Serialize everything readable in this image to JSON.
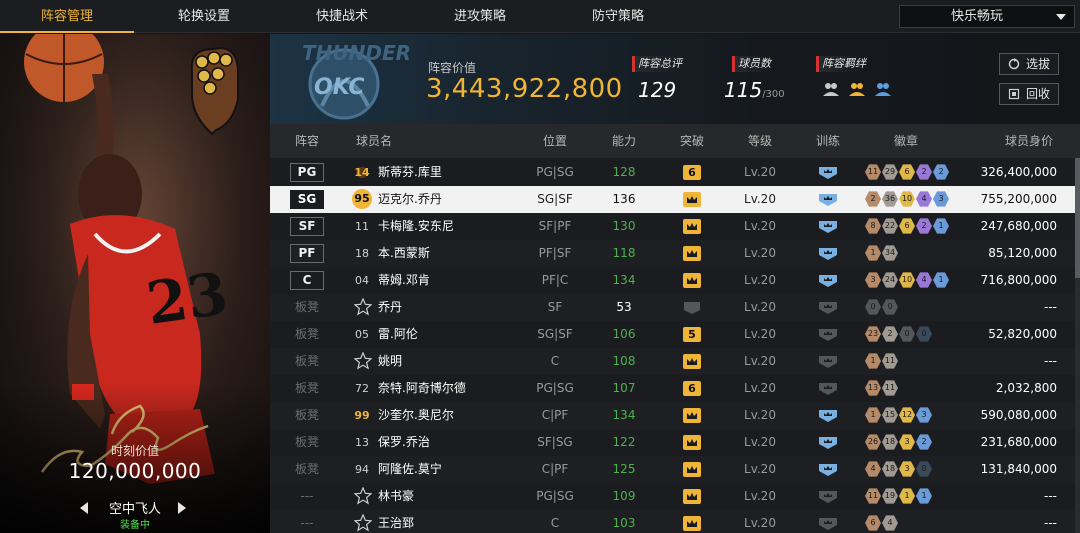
{
  "tabs": [
    {
      "label": "阵容管理",
      "active": true
    },
    {
      "label": "轮换设置",
      "active": false
    },
    {
      "label": "快捷战术",
      "active": false
    },
    {
      "label": "进攻策略",
      "active": false
    },
    {
      "label": "防守策略",
      "active": false
    }
  ],
  "mode_select": {
    "value": "快乐畅玩"
  },
  "card": {
    "value_label": "时刻价值",
    "value": "120,000,000",
    "name": "空中飞人",
    "status": "装备中"
  },
  "header": {
    "lineup_value_label": "阵容价值",
    "lineup_value": "3,443,922,800",
    "rating_label": "阵容总评",
    "rating": "129",
    "players_label": "球员数",
    "players": "115",
    "players_max": "/300",
    "chem_label": "阵容羁绊",
    "btn_scout": "选拔",
    "btn_recall": "回收"
  },
  "columns": [
    "阵容",
    "球员名",
    "位置",
    "能力",
    "突破",
    "等级",
    "训练",
    "徽章",
    "球员身价"
  ],
  "colors": {
    "accent": "#f0b436",
    "green": "#4eb04e",
    "red": "#d63232"
  },
  "rows": [
    {
      "slot": "PG",
      "starter": true,
      "num": "14",
      "num_style": "gold-star",
      "name": "斯蒂芬.库里",
      "pos": "PG|SG",
      "ovr": "128",
      "ovr_color": "green",
      "break": "6",
      "level": "Lv.20",
      "train": true,
      "badges": [
        [
          "11",
          "#b58a68"
        ],
        [
          "29",
          "#a09a92"
        ],
        [
          "6",
          "#e0b84a"
        ],
        [
          "2",
          "#9a78d8"
        ],
        [
          "2",
          "#6a9ad8"
        ]
      ],
      "price": "326,400,000"
    },
    {
      "slot": "SG",
      "starter": true,
      "num": "95",
      "num_style": "gold-circle",
      "name": "迈克尔.乔丹",
      "pos": "SG|SF",
      "ovr": "136",
      "ovr_color": "white",
      "break": "crown",
      "level": "Lv.20",
      "train": true,
      "badges": [
        [
          "2",
          "#b58a68"
        ],
        [
          "36",
          "#a09a92"
        ],
        [
          "10",
          "#e0b84a"
        ],
        [
          "4",
          "#9a78d8"
        ],
        [
          "3",
          "#6a9ad8"
        ]
      ],
      "price": "755,200,000",
      "selected": true
    },
    {
      "slot": "SF",
      "starter": true,
      "num": "11",
      "num_style": "plain",
      "name": "卡梅隆.安东尼",
      "pos": "SF|PF",
      "ovr": "130",
      "ovr_color": "green",
      "break": "crown",
      "level": "Lv.20",
      "train": true,
      "badges": [
        [
          "8",
          "#b58a68"
        ],
        [
          "22",
          "#a09a92"
        ],
        [
          "6",
          "#e0b84a"
        ],
        [
          "2",
          "#9a78d8"
        ],
        [
          "1",
          "#6a9ad8"
        ]
      ],
      "price": "247,680,000"
    },
    {
      "slot": "PF",
      "starter": true,
      "num": "18",
      "num_style": "plain",
      "name": "本.西蒙斯",
      "pos": "PF|SF",
      "ovr": "118",
      "ovr_color": "green",
      "break": "crown",
      "level": "Lv.20",
      "train": true,
      "badges": [
        [
          "1",
          "#b58a68"
        ],
        [
          "34",
          "#a09a92"
        ]
      ],
      "price": "85,120,000"
    },
    {
      "slot": "C",
      "starter": true,
      "num": "04",
      "num_style": "plain",
      "name": "蒂姆.邓肯",
      "pos": "PF|C",
      "ovr": "134",
      "ovr_color": "green",
      "break": "crown",
      "level": "Lv.20",
      "train": true,
      "badges": [
        [
          "3",
          "#b58a68"
        ],
        [
          "24",
          "#a09a92"
        ],
        [
          "10",
          "#e0b84a"
        ],
        [
          "4",
          "#9a78d8"
        ],
        [
          "1",
          "#6a9ad8"
        ]
      ],
      "price": "716,800,000"
    },
    {
      "slot": "板凳",
      "starter": false,
      "num": "",
      "num_style": "star",
      "name": "乔丹",
      "pos": "SF",
      "ovr": "53",
      "ovr_color": "white",
      "break": "none",
      "level": "Lv.20",
      "train": false,
      "badges": [
        [
          "0",
          "#55565a"
        ],
        [
          "0",
          "#55565a"
        ]
      ],
      "price": "---"
    },
    {
      "slot": "板凳",
      "starter": false,
      "num": "05",
      "num_style": "plain",
      "name": "雷.阿伦",
      "pos": "SG|SF",
      "ovr": "106",
      "ovr_color": "green",
      "break": "5",
      "level": "Lv.20",
      "train": false,
      "badges": [
        [
          "23",
          "#b58a68"
        ],
        [
          "2",
          "#a09a92"
        ],
        [
          "0",
          "#55565a"
        ],
        [
          "0",
          "#3a4a5a"
        ]
      ],
      "price": "52,820,000"
    },
    {
      "slot": "板凳",
      "starter": false,
      "num": "",
      "num_style": "star",
      "name": "姚明",
      "pos": "C",
      "ovr": "108",
      "ovr_color": "green",
      "break": "crown",
      "level": "Lv.20",
      "train": false,
      "badges": [
        [
          "1",
          "#b58a68"
        ],
        [
          "11",
          "#a09a92"
        ]
      ],
      "price": "---"
    },
    {
      "slot": "板凳",
      "starter": false,
      "num": "72",
      "num_style": "plain",
      "name": "奈特.阿奇博尔德",
      "pos": "PG|SG",
      "ovr": "107",
      "ovr_color": "green",
      "break": "6",
      "level": "Lv.20",
      "train": false,
      "badges": [
        [
          "13",
          "#b58a68"
        ],
        [
          "11",
          "#a09a92"
        ]
      ],
      "price": "2,032,800"
    },
    {
      "slot": "板凳",
      "starter": false,
      "num": "99",
      "num_style": "gold",
      "name": "沙奎尔.奥尼尔",
      "pos": "C|PF",
      "ovr": "134",
      "ovr_color": "green",
      "break": "crown",
      "level": "Lv.20",
      "train": true,
      "badges": [
        [
          "1",
          "#b58a68"
        ],
        [
          "15",
          "#a09a92"
        ],
        [
          "12",
          "#e0b84a"
        ],
        [
          "3",
          "#6a9ad8"
        ]
      ],
      "price": "590,080,000"
    },
    {
      "slot": "板凳",
      "starter": false,
      "num": "13",
      "num_style": "plain",
      "name": "保罗.乔治",
      "pos": "SF|SG",
      "ovr": "122",
      "ovr_color": "green",
      "break": "crown",
      "level": "Lv.20",
      "train": true,
      "badges": [
        [
          "26",
          "#b58a68"
        ],
        [
          "18",
          "#a09a92"
        ],
        [
          "3",
          "#e0b84a"
        ],
        [
          "2",
          "#6a9ad8"
        ]
      ],
      "price": "231,680,000"
    },
    {
      "slot": "板凳",
      "starter": false,
      "num": "94",
      "num_style": "plain",
      "name": "阿隆佐.莫宁",
      "pos": "C|PF",
      "ovr": "125",
      "ovr_color": "green",
      "break": "crown",
      "level": "Lv.20",
      "train": true,
      "badges": [
        [
          "4",
          "#b58a68"
        ],
        [
          "18",
          "#a09a92"
        ],
        [
          "3",
          "#e0b84a"
        ],
        [
          "0",
          "#3a4a5a"
        ]
      ],
      "price": "131,840,000"
    },
    {
      "slot": "---",
      "starter": false,
      "num": "",
      "num_style": "star",
      "name": "林书豪",
      "pos": "PG|SG",
      "ovr": "109",
      "ovr_color": "green",
      "break": "crown",
      "level": "Lv.20",
      "train": false,
      "badges": [
        [
          "11",
          "#b58a68"
        ],
        [
          "19",
          "#a09a92"
        ],
        [
          "1",
          "#e0b84a"
        ],
        [
          "1",
          "#6a9ad8"
        ]
      ],
      "price": "---"
    },
    {
      "slot": "---",
      "starter": false,
      "num": "",
      "num_style": "star",
      "name": "王治郅",
      "pos": "C",
      "ovr": "103",
      "ovr_color": "green",
      "break": "crown",
      "level": "Lv.20",
      "train": false,
      "badges": [
        [
          "6",
          "#b58a68"
        ],
        [
          "4",
          "#a09a92"
        ]
      ],
      "price": "---"
    }
  ]
}
